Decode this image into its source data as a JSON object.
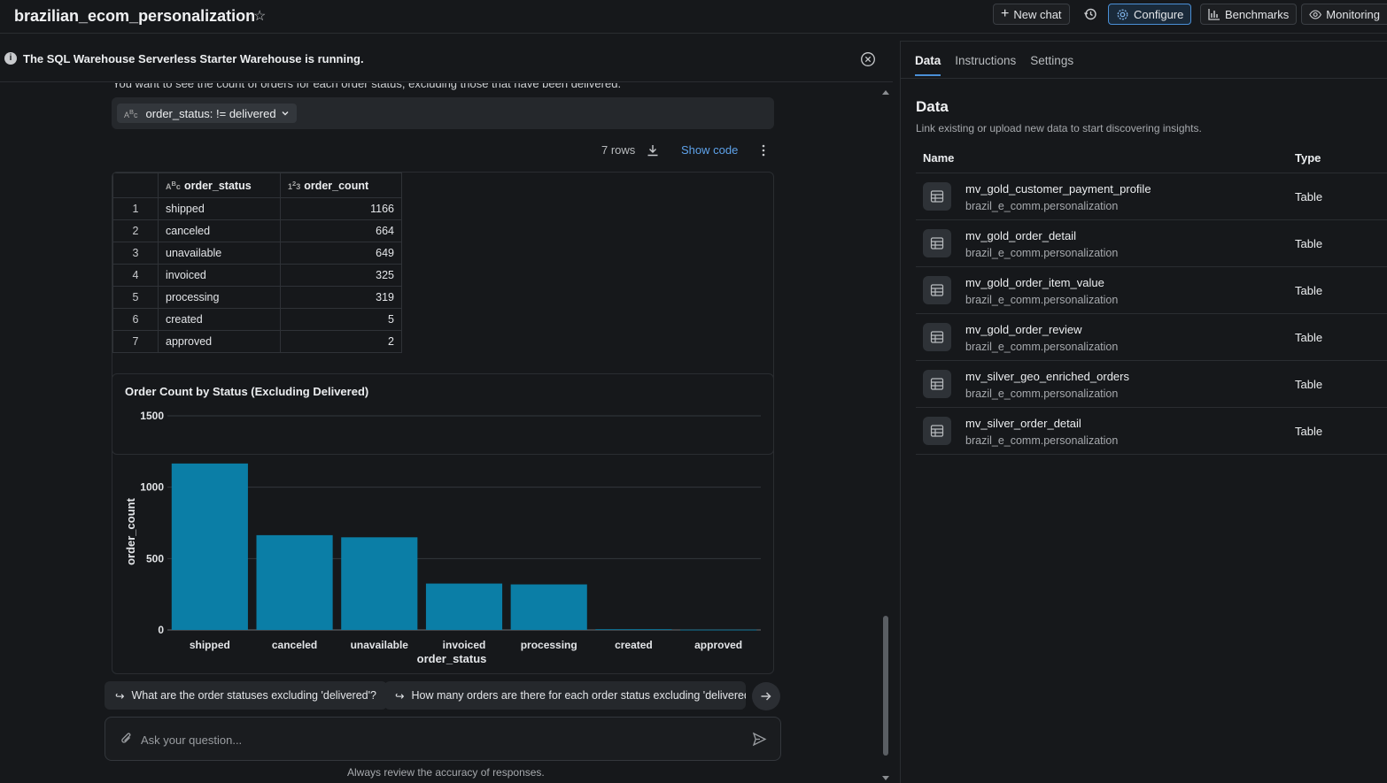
{
  "header": {
    "title": "brazilian_ecom_personalization",
    "new_chat": "New chat",
    "configure": "Configure",
    "benchmarks": "Benchmarks",
    "monitoring": "Monitoring"
  },
  "banner": {
    "text": "The SQL Warehouse Serverless Starter Warehouse is running."
  },
  "chat": {
    "intro_text": "You want to see the count of orders for each order status, excluding those that have been delivered.",
    "filter_chip": "order_status: != delivered",
    "rows_label": "7 rows",
    "show_code": "Show code",
    "table": {
      "columns": [
        "order_status",
        "order_count"
      ],
      "rows": [
        {
          "idx": "1",
          "status": "shipped",
          "count": "1166"
        },
        {
          "idx": "2",
          "status": "canceled",
          "count": "664"
        },
        {
          "idx": "3",
          "status": "unavailable",
          "count": "649"
        },
        {
          "idx": "4",
          "status": "invoiced",
          "count": "325"
        },
        {
          "idx": "5",
          "status": "processing",
          "count": "319"
        },
        {
          "idx": "6",
          "status": "created",
          "count": "5"
        },
        {
          "idx": "7",
          "status": "approved",
          "count": "2"
        }
      ]
    },
    "suggestions": [
      "What are the order statuses excluding 'delivered'?",
      "How many orders are there for each order status excluding 'delivered'?"
    ],
    "ask_placeholder": "Ask your question...",
    "disclaimer": "Always review the accuracy of responses."
  },
  "chart_data": {
    "type": "bar",
    "title": "Order Count by Status (Excluding Delivered)",
    "xlabel": "order_status",
    "ylabel": "order_count",
    "categories": [
      "shipped",
      "canceled",
      "unavailable",
      "invoiced",
      "processing",
      "created",
      "approved"
    ],
    "values": [
      1166,
      664,
      649,
      325,
      319,
      5,
      2
    ],
    "ylim": [
      0,
      1500
    ],
    "yticks": [
      0,
      500,
      1000,
      1500
    ],
    "grid": true,
    "bar_color": "#0b7ea6"
  },
  "panel": {
    "tabs": [
      "Data",
      "Instructions",
      "Settings"
    ],
    "heading": "Data",
    "subtitle": "Link existing or upload new data to start discovering insights.",
    "col_name": "Name",
    "col_type": "Type",
    "items": [
      {
        "name": "mv_gold_customer_payment_profile",
        "schema": "brazil_e_comm.personalization",
        "type": "Table"
      },
      {
        "name": "mv_gold_order_detail",
        "schema": "brazil_e_comm.personalization",
        "type": "Table"
      },
      {
        "name": "mv_gold_order_item_value",
        "schema": "brazil_e_comm.personalization",
        "type": "Table"
      },
      {
        "name": "mv_gold_order_review",
        "schema": "brazil_e_comm.personalization",
        "type": "Table"
      },
      {
        "name": "mv_silver_geo_enriched_orders",
        "schema": "brazil_e_comm.personalization",
        "type": "Table"
      },
      {
        "name": "mv_silver_order_detail",
        "schema": "brazil_e_comm.personalization",
        "type": "Table"
      }
    ]
  }
}
